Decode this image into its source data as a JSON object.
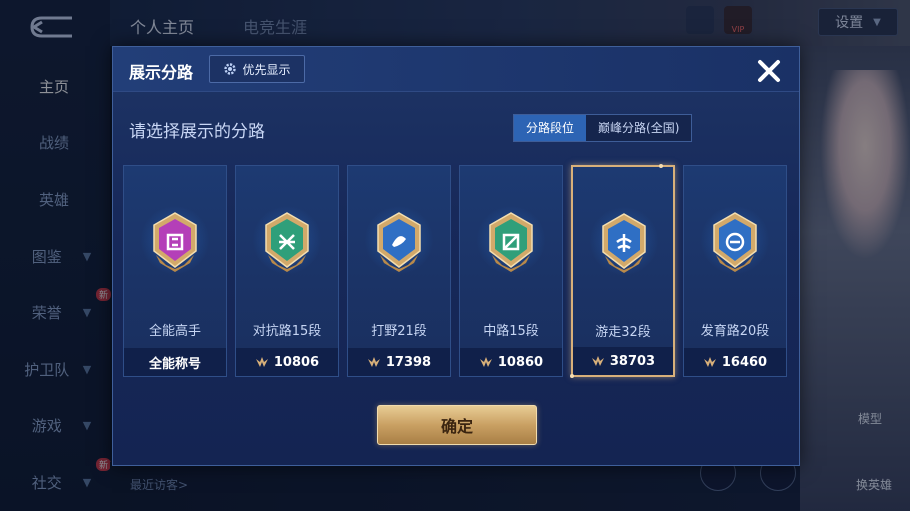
{
  "background": {
    "top_tabs": [
      "个人主页",
      "电竞生涯"
    ],
    "sidebar": [
      {
        "label": "主页",
        "active": true,
        "chevron": false,
        "new": false
      },
      {
        "label": "战绩",
        "active": false,
        "chevron": false,
        "new": false
      },
      {
        "label": "英雄",
        "active": false,
        "chevron": false,
        "new": false
      },
      {
        "label": "图鉴",
        "active": false,
        "chevron": true,
        "new": false
      },
      {
        "label": "荣誉",
        "active": false,
        "chevron": true,
        "new": true
      },
      {
        "label": "护卫队",
        "active": false,
        "chevron": true,
        "new": false
      },
      {
        "label": "游戏",
        "active": false,
        "chevron": true,
        "new": false
      },
      {
        "label": "社交",
        "active": false,
        "chevron": true,
        "new": true
      }
    ],
    "new_badge": "新",
    "settings_label": "设置",
    "vip_label": "VIP",
    "visitor_label": "最近访客>",
    "model_label": "模型",
    "swap_hero_label": "换英雄"
  },
  "modal": {
    "title": "展示分路",
    "priority_label": "优先显示",
    "subtitle": "请选择展示的分路",
    "segment": {
      "options": [
        "分路段位",
        "巅峰分路(全国)"
      ],
      "selected": "分路段位"
    },
    "cards": [
      {
        "name": "全能高手",
        "bottom": "全能称号",
        "score": null,
        "selected": false,
        "emblem": "all-round-emblem-icon",
        "color": "#b43fb8"
      },
      {
        "name": "对抗路15段",
        "bottom": null,
        "score": "10806",
        "selected": false,
        "emblem": "clash-lane-emblem-icon",
        "color": "#2f9f7a"
      },
      {
        "name": "打野21段",
        "bottom": null,
        "score": "17398",
        "selected": false,
        "emblem": "jungle-emblem-icon",
        "color": "#2f6fc4"
      },
      {
        "name": "中路15段",
        "bottom": null,
        "score": "10860",
        "selected": false,
        "emblem": "mid-lane-emblem-icon",
        "color": "#2f9f7a"
      },
      {
        "name": "游走32段",
        "bottom": null,
        "score": "38703",
        "selected": true,
        "emblem": "roam-emblem-icon",
        "color": "#2f6fc4"
      },
      {
        "name": "发育路20段",
        "bottom": null,
        "score": "16460",
        "selected": false,
        "emblem": "farm-lane-emblem-icon",
        "color": "#2f6fc4"
      }
    ],
    "confirm_label": "确定"
  },
  "colors": {
    "accent_gold": "#d8b07a",
    "selected_tab": "#2d64b4",
    "modal_bg": "#17295a"
  }
}
